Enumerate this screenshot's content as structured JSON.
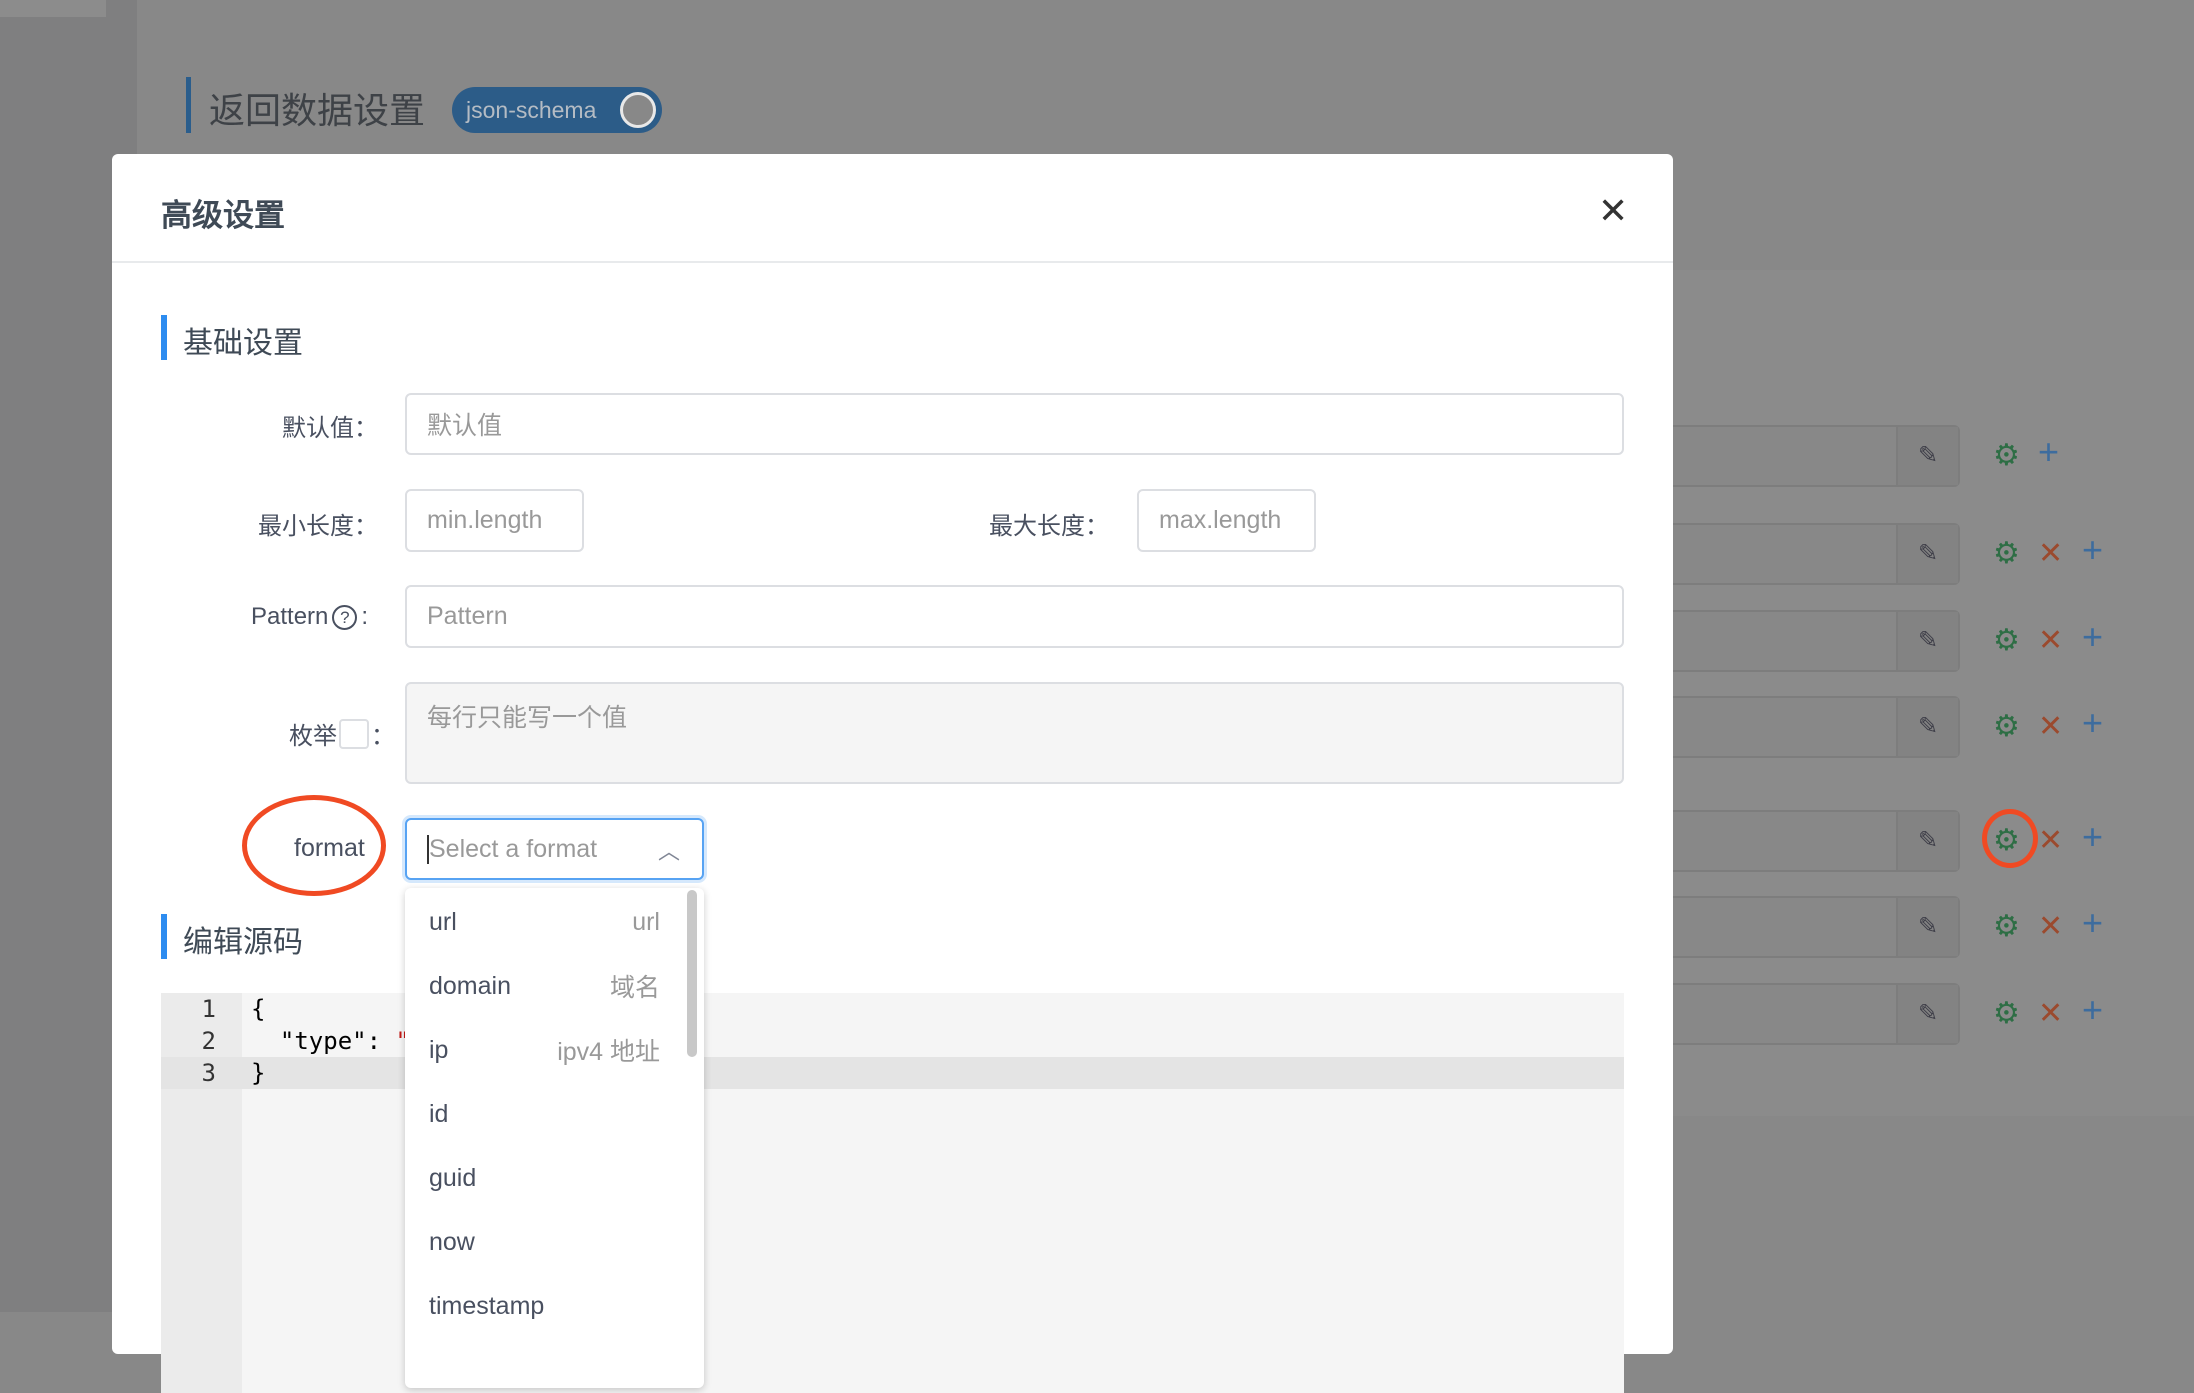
{
  "background": {
    "title": "返回数据设置",
    "toggle_label": "json-schema",
    "rows": [
      {
        "edit_icon": "✎",
        "actions": [
          "gear",
          "add"
        ]
      },
      {
        "edit_icon": "✎",
        "actions": [
          "gear",
          "delete",
          "add"
        ]
      },
      {
        "edit_icon": "✎",
        "actions": [
          "gear",
          "delete",
          "add"
        ]
      },
      {
        "edit_icon": "✎",
        "actions": [
          "gear",
          "delete",
          "add"
        ]
      },
      {
        "edit_icon": "✎",
        "actions": [
          "gear",
          "delete",
          "add"
        ],
        "highlighted": true
      },
      {
        "edit_icon": "✎",
        "actions": [
          "gear",
          "delete",
          "add"
        ]
      },
      {
        "edit_icon": "✎",
        "actions": [
          "gear",
          "delete",
          "add"
        ]
      }
    ]
  },
  "modal": {
    "title": "高级设置",
    "close_icon": "✕",
    "basic_section": "基础设置",
    "default_label": "默认值：",
    "default_placeholder": "默认值",
    "min_label": "最小长度：",
    "min_placeholder": "min.length",
    "max_label": "最大长度：",
    "max_placeholder": "max.length",
    "pattern_label": "Pattern",
    "pattern_help": "?",
    "pattern_placeholder": "Pattern",
    "enum_label": "枚举",
    "enum_placeholder": "每行只能写一个值",
    "format_label": "format",
    "format_placeholder": "Select a format",
    "format_options": [
      {
        "value": "url",
        "desc": "url"
      },
      {
        "value": "domain",
        "desc": "域名"
      },
      {
        "value": "ip",
        "desc": "ipv4 地址"
      },
      {
        "value": "id",
        "desc": ""
      },
      {
        "value": "guid",
        "desc": ""
      },
      {
        "value": "now",
        "desc": ""
      },
      {
        "value": "timestamp",
        "desc": ""
      }
    ],
    "source_section": "编辑源码",
    "code_lines": [
      {
        "num": "1",
        "text": "{"
      },
      {
        "num": "2",
        "text": "  \"type\": ",
        "str": "\""
      },
      {
        "num": "3",
        "text": "}"
      }
    ]
  },
  "colors": {
    "accent": "#2d8cf0",
    "annotation": "#f04a23",
    "gear": "#2e6e45",
    "delete": "#9b4a2e",
    "add": "#3d6c9e"
  }
}
